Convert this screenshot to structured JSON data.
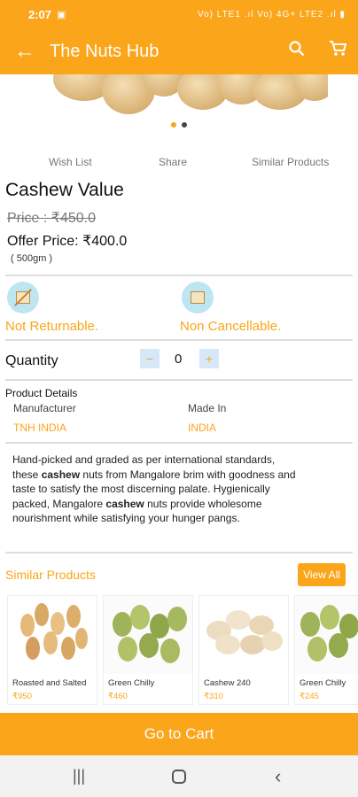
{
  "status": {
    "time": "2:07",
    "right": "Vo) LTE1 .ıl Vo) 4G+ LTE2 .ıl ▮"
  },
  "appbar": {
    "title": "The Nuts Hub"
  },
  "actions": [
    "Wish List",
    "Share",
    "Similar Products"
  ],
  "product": {
    "name": "Cashew Value",
    "old_price": "Price : ₹450.0",
    "offer_price": "Offer Price: ₹400.0",
    "weight": "( 500gm )"
  },
  "policies": {
    "returnable": "Not Returnable.",
    "cancellable": "Non Cancellable."
  },
  "quantity": {
    "label": "Quantity",
    "value": "0",
    "minus": "−",
    "plus": "+"
  },
  "details": {
    "title": "Product Details",
    "manufacturer_label": "Manufacturer",
    "manufacturer": "TNH INDIA",
    "madein_label": "Made In",
    "madein": "INDIA"
  },
  "description": {
    "line1": "Hand-picked and graded as per international standards,",
    "line2a": "these ",
    "line2b": "cashew",
    "line2c": " nuts from Mangalore brim with goodness and",
    "line3": "taste to satisfy the most discerning palate. Hygienically",
    "line4a": "packed, Mangalore ",
    "line4b": "cashew",
    "line4c": " nuts provide wholesome",
    "line5": "nourishment while satisfying your hunger pangs."
  },
  "similar": {
    "title": "Similar Products",
    "view_all": "View All",
    "items": [
      {
        "name": "Roasted and Salted",
        "price": "₹950"
      },
      {
        "name": "Green Chilly",
        "price": "₹460"
      },
      {
        "name": "Cashew 240",
        "price": "₹310"
      },
      {
        "name": "Green Chilly",
        "price": "₹245"
      }
    ]
  },
  "go_to_cart": "Go to Cart",
  "colors": {
    "accent": "#fba51a",
    "light_blue": "#bde6f2"
  }
}
